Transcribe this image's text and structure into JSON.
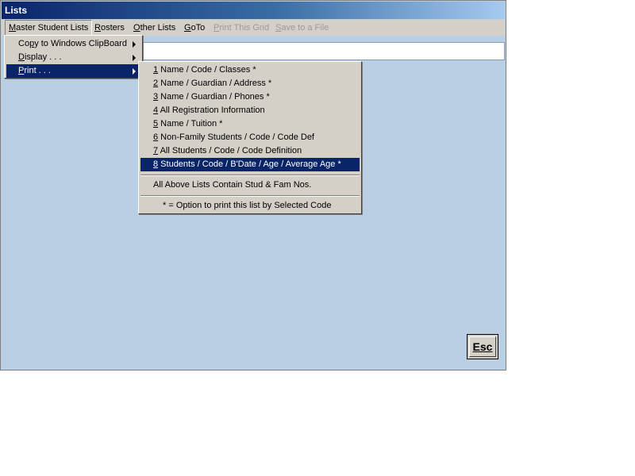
{
  "window": {
    "title": "Lists"
  },
  "menubar": {
    "items": [
      {
        "pre": "",
        "u": "M",
        "post": "aster Student Lists"
      },
      {
        "pre": "",
        "u": "R",
        "post": "osters"
      },
      {
        "pre": "",
        "u": "O",
        "post": "ther Lists"
      },
      {
        "pre": "",
        "u": "G",
        "post": "oTo"
      },
      {
        "pre": "",
        "u": "P",
        "post": "rint This Grid"
      },
      {
        "pre": "",
        "u": "S",
        "post": "ave to a File"
      }
    ]
  },
  "master_menu": {
    "items": [
      {
        "pre": "Co",
        "u": "p",
        "post": "y to Windows ClipBoard"
      },
      {
        "pre": "",
        "u": "D",
        "post": "isplay . . ."
      },
      {
        "pre": "",
        "u": "P",
        "post": "rint . . ."
      }
    ]
  },
  "print_menu": {
    "items": [
      {
        "num": "1",
        "text": " Name / Code / Classes *"
      },
      {
        "num": "2",
        "text": " Name / Guardian / Address *"
      },
      {
        "num": "3",
        "text": " Name / Guardian / Phones *"
      },
      {
        "num": "4",
        "text": " All Registration Information"
      },
      {
        "num": "5",
        "text": " Name / Tuition *"
      },
      {
        "num": "6",
        "text": " Non-Family Students / Code / Code Def"
      },
      {
        "num": "7",
        "text": " All Students / Code / Code Definition"
      },
      {
        "num": "8",
        "text": " Students / Code / B'Date / Age / Average Age *"
      }
    ],
    "note1": "All Above Lists Contain Stud & Fam Nos.",
    "note2": "* = Option to print this list by Selected Code"
  },
  "esc_button": {
    "label": "Esc"
  }
}
